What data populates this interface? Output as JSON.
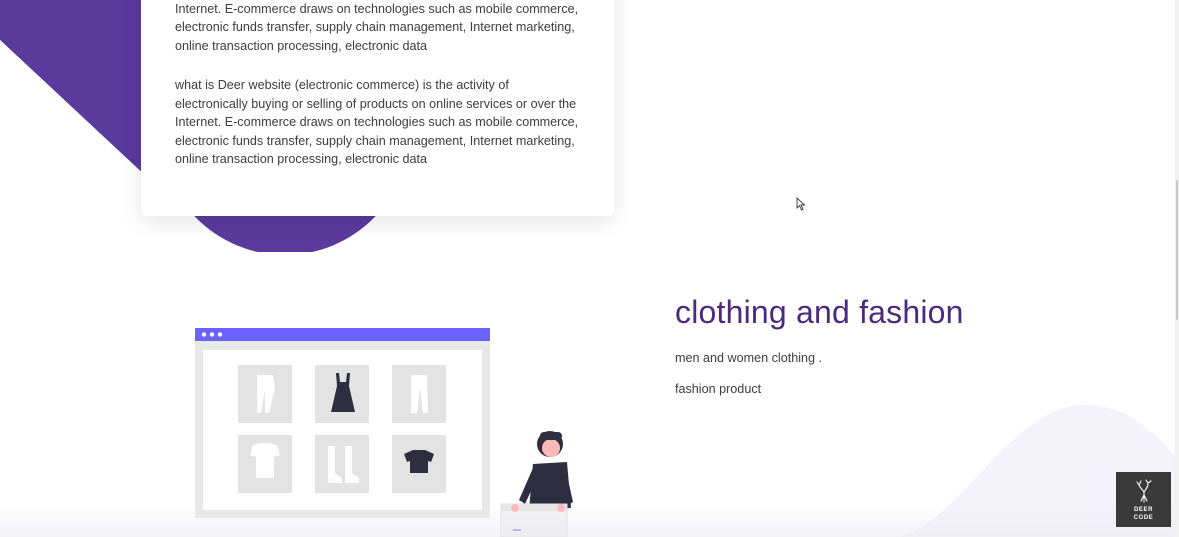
{
  "article": {
    "para_1": "electronically buying or selling of products on online services or over the Internet. E-commerce draws on technologies such as mobile commerce, electronic funds transfer, supply chain management, Internet marketing, online transaction processing, electronic data",
    "para_2": "what is Deer website (electronic commerce) is the activity of electronically buying or selling of products on online services or over the Internet. E-commerce draws on technologies such as mobile commerce, electronic funds transfer, supply chain management, Internet marketing, online transaction processing, electronic data"
  },
  "fashion": {
    "title": "clothing and fashion",
    "line_1": "men and women clothing .",
    "line_2": "fashion product"
  },
  "watermark": {
    "line_1": "DEER",
    "line_2": "CODE"
  },
  "colors": {
    "accent_purple": "#5b3a9e",
    "title_purple": "#4b2a7f",
    "browser_bar": "#6c63ff"
  },
  "icons": {
    "cursor": "arrow-cursor-icon",
    "watermark": "deer-logo-icon"
  }
}
